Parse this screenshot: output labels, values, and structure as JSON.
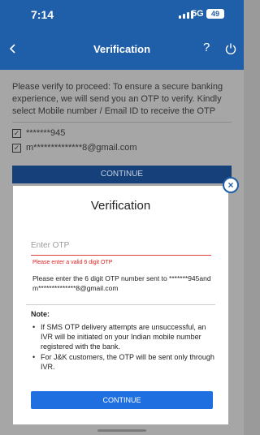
{
  "status_bar": {
    "time": "7:14",
    "network": "5G",
    "battery": "49"
  },
  "header": {
    "title": "Verification",
    "help_icon": "question-icon",
    "power_icon": "power-icon",
    "back_icon": "chevron-left-icon"
  },
  "background": {
    "intro": "Please verify to proceed: To ensure a secure banking experience, we will send you an OTP to verify. Kindly select Mobile number / Email ID to receive the OTP",
    "options": [
      {
        "label": "*******945",
        "checked": true
      },
      {
        "label": "m**************8@gmail.com",
        "checked": true
      }
    ],
    "continue_label": "CONTINUE"
  },
  "modal": {
    "title": "Verification",
    "otp_placeholder": "Enter OTP",
    "otp_value": "",
    "error": "Please enter a valid 6 digit OTP",
    "info": "Please enter the 6 digit OTP number sent to *******945and m**************8@gmail.com",
    "note_heading": "Note:",
    "notes": [
      "If SMS OTP delivery attempts are unsuccessful, an IVR will be initiated on your Indian mobile number registered with the bank.",
      "For J&K customers, the OTP will be sent only through IVR."
    ],
    "continue_label": "CONTINUE",
    "close_icon": "close-icon"
  },
  "colors": {
    "primary": "#1f5ea8",
    "button": "#1f6fe0",
    "error": "#dd2222"
  }
}
